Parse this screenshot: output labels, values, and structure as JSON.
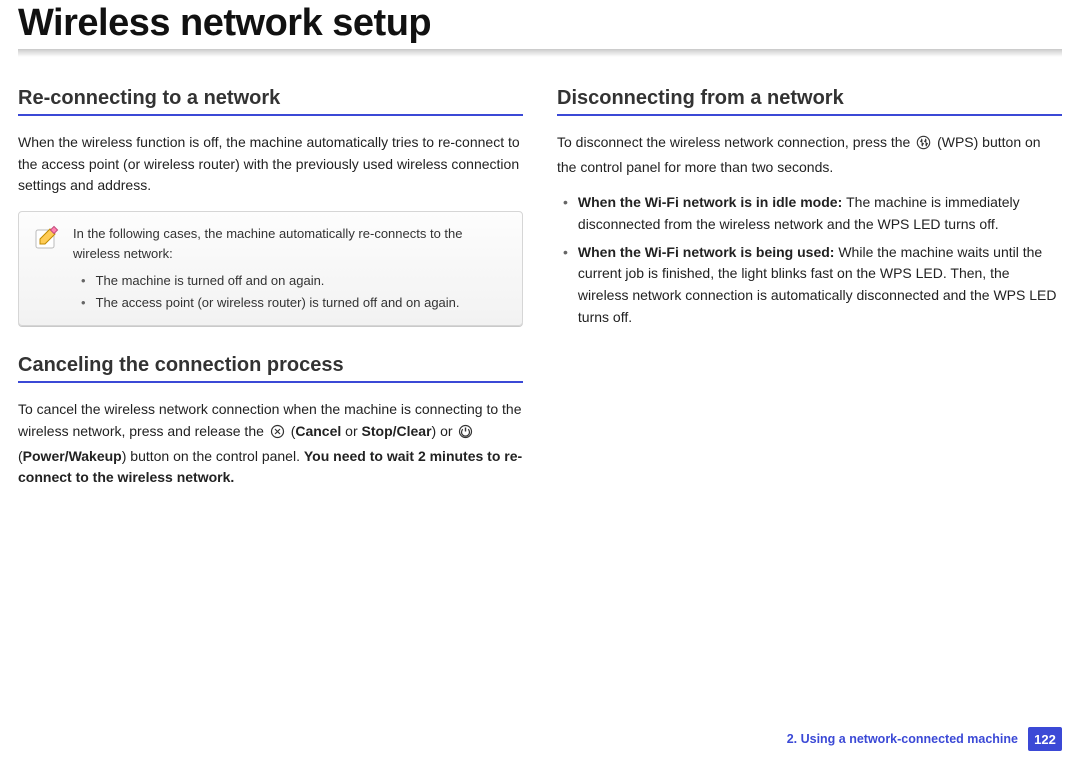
{
  "page": {
    "title": "Wireless network setup"
  },
  "left": {
    "sec1": {
      "heading": "Re-connecting to a network",
      "para": "When the wireless function is off, the machine automatically tries to re-connect to the access point (or wireless router) with the previously used wireless connection settings and address."
    },
    "note": {
      "intro": "In the following cases, the machine automatically re-connects to the wireless network:",
      "item1": "The machine is turned off and on again.",
      "item2": "The access point (or wireless router) is turned off and on again."
    },
    "sec2": {
      "heading": "Canceling the connection process",
      "para_pre": "To cancel the wireless network connection when the machine is connecting to the wireless network, press and release the ",
      "cancel_label": "Cancel",
      "or1": " or ",
      "stopclear_label": "Stop/Clear",
      "paren_close_or": ") or ",
      "power_label": "Power/Wakeup",
      "para_mid": ") button on the control panel. ",
      "bold_tail": "You need to wait 2 minutes to re-connect to the wireless network."
    }
  },
  "right": {
    "sec1": {
      "heading": "Disconnecting from a network",
      "para_pre": "To disconnect the wireless network connection, press the ",
      "wps_label": " (WPS) button on the control panel for more than two seconds."
    },
    "b1": {
      "lead": "When the Wi-Fi network is in idle mode: ",
      "body": "The machine is immediately disconnected from the wireless network and the WPS LED turns off."
    },
    "b2": {
      "lead": "When the Wi-Fi network is being used: ",
      "body": "While the machine waits until the current job is finished, the light blinks fast on the WPS LED. Then, the wireless network connection is automatically disconnected and the WPS LED turns off."
    }
  },
  "footer": {
    "chapter": "2.  Using a network-connected machine",
    "page_number": "122"
  }
}
